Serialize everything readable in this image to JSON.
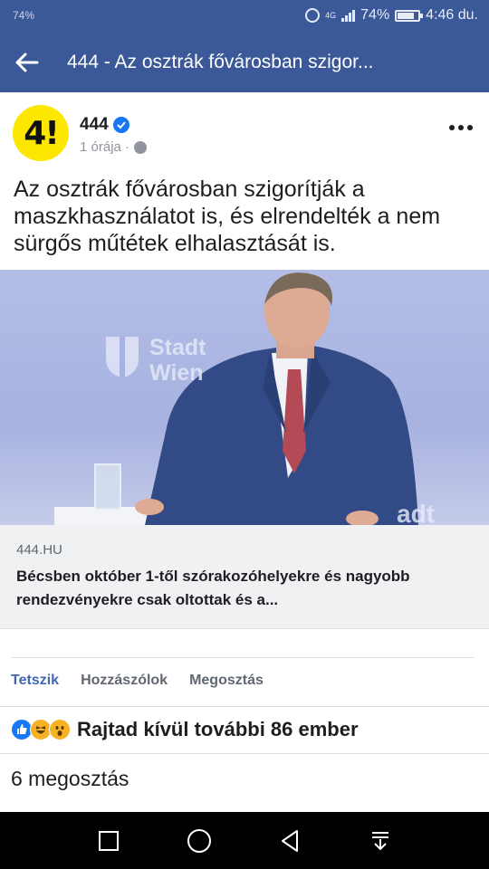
{
  "status_bar": {
    "left": "74%",
    "battery": "74%",
    "time": "4:46 du.",
    "network": "4G"
  },
  "app_bar": {
    "title": "444 - Az osztrák fővárosban szigor..."
  },
  "post": {
    "author": "444",
    "avatar_text": "4!",
    "time": "1 órája ·",
    "text": "Az osztrák fővárosban szigorítják a maszkhasználatot is, és elrendelték a nem sürgős műtétek elhalasztását is."
  },
  "link": {
    "image_text_1": "Stadt",
    "image_text_2": "Wien",
    "image_text_3": "adt",
    "domain": "444.HU",
    "title": "Bécsben október 1-től szórakozóhelyekre és nagyobb rendezvényekre csak oltottak és a..."
  },
  "actions": {
    "like": "Tetszik",
    "comment": "Hozzászólok",
    "share": "Megosztás"
  },
  "reactions": {
    "text": "Rajtad kívül további 86 ember"
  },
  "shares": "6 megosztás",
  "colors": {
    "header": "#3b5998",
    "like": "#4267b2",
    "avatar": "#fde600"
  }
}
